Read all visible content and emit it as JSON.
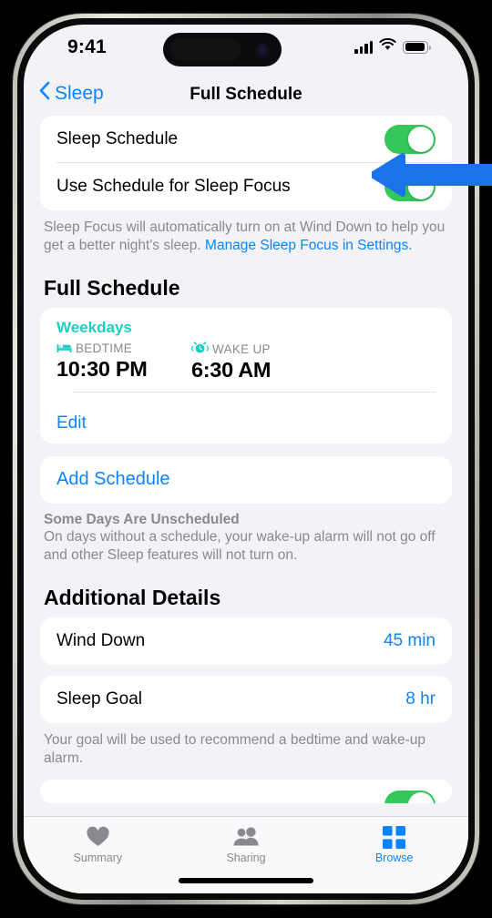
{
  "status_bar": {
    "time": "9:41",
    "signal_icon": "cellular-signal-icon",
    "wifi_icon": "wifi-icon",
    "battery_icon": "battery-icon"
  },
  "nav": {
    "back_label": "Sleep",
    "back_icon": "chevron-left-icon",
    "title": "Full Schedule"
  },
  "toggles_card": {
    "rows": [
      {
        "label": "Sleep Schedule",
        "value": "on"
      },
      {
        "label": "Use Schedule for Sleep Focus",
        "value": "on"
      }
    ],
    "footer_text_before": "Sleep Focus will automatically turn on at Wind Down to help you get a better night's sleep. ",
    "footer_link": "Manage Sleep Focus in Settings."
  },
  "full_schedule": {
    "section_title": "Full Schedule",
    "days": "Weekdays",
    "bedtime_icon": "bed-icon",
    "bedtime_label": "BEDTIME",
    "bedtime_value": "10:30 PM",
    "wakeup_icon": "alarm-clock-icon",
    "wakeup_label": "WAKE UP",
    "wakeup_value": "6:30 AM",
    "edit_label": "Edit",
    "add_schedule_label": "Add Schedule",
    "unscheduled_title": "Some Days Are Unscheduled",
    "unscheduled_text": "On days without a schedule, your wake-up alarm will not go off and other Sleep features will not turn on."
  },
  "additional_details": {
    "section_title": "Additional Details",
    "wind_down": {
      "label": "Wind Down",
      "value": "45 min"
    },
    "sleep_goal": {
      "label": "Sleep Goal",
      "value": "8 hr"
    },
    "sleep_goal_footer": "Your goal will be used to recommend a bedtime and wake-up alarm."
  },
  "tab_bar": {
    "tabs": [
      {
        "label": "Summary",
        "icon": "heart-icon",
        "active": false
      },
      {
        "label": "Sharing",
        "icon": "people-icon",
        "active": false
      },
      {
        "label": "Browse",
        "icon": "grid-icon",
        "active": true
      }
    ]
  },
  "colors": {
    "accent_blue": "#0a84ff",
    "toggle_green": "#34c759",
    "teal": "#1ecfc4",
    "background": "#f2f2f7",
    "annotation_blue": "#1a73e8"
  }
}
